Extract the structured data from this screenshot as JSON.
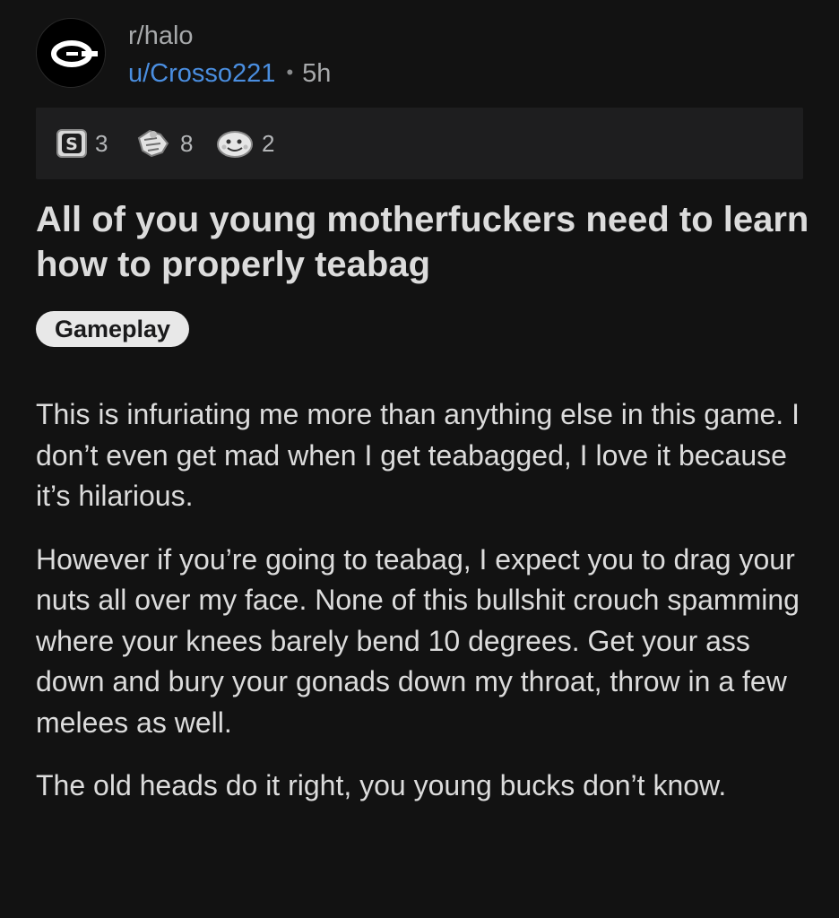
{
  "post": {
    "subreddit": "r/halo",
    "author": "u/Crosso221",
    "separator": "•",
    "time_ago": "5h",
    "awards": [
      {
        "icon": "silver-award-icon",
        "count": "3"
      },
      {
        "icon": "helpful-award-icon",
        "count": "8"
      },
      {
        "icon": "wholesome-award-icon",
        "count": "2"
      }
    ],
    "title": "All of you young motherfuckers need to learn how to properly teabag",
    "flair": "Gameplay",
    "body": [
      "This is infuriating me more than anything else in this game. I don’t even get mad when I get teabagged, I love it because it’s hilarious.",
      "However if you’re going to teabag, I expect you to drag your nuts all over my face. None of this bullshit crouch spamming where your knees barely bend 10 degrees. Get your ass down and bury your gonads down my throat, throw in a few melees as well.",
      "The old heads do it right, you young bucks don’t know."
    ]
  },
  "colors": {
    "background": "#121212",
    "username": "#4a8ee0",
    "flair_bg": "#e8e8e8",
    "text": "#dcdcdc"
  }
}
